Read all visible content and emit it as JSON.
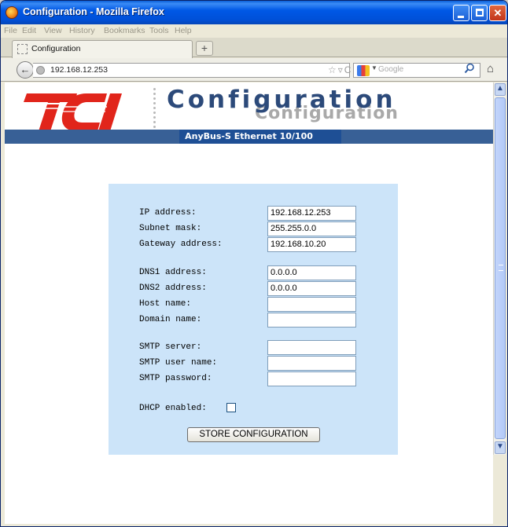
{
  "window": {
    "title": "Configuration - Mozilla Firefox"
  },
  "menu": [
    "File",
    "Edit",
    "View",
    "History",
    "Bookmarks",
    "Tools",
    "Help"
  ],
  "tab": {
    "label": "Configuration",
    "new_tab_label": "+"
  },
  "nav": {
    "url": "192.168.12.253",
    "search_placeholder": "Google",
    "back_label": "←"
  },
  "page": {
    "logo_text": "TCI",
    "heading": "Configuration",
    "heading_shadow": "Configuration",
    "subtitle": "AnyBus-S Ethernet 10/100"
  },
  "form": {
    "ip_label": "IP address:",
    "ip_value": "192.168.12.253",
    "subnet_label": "Subnet mask:",
    "subnet_value": "255.255.0.0",
    "gateway_label": "Gateway address:",
    "gateway_value": "192.168.10.20",
    "dns1_label": "DNS1 address:",
    "dns1_value": "0.0.0.0",
    "dns2_label": "DNS2 address:",
    "dns2_value": "0.0.0.0",
    "host_label": "Host name:",
    "host_value": "",
    "domain_label": "Domain name:",
    "domain_value": "",
    "smtp_server_label": "SMTP server:",
    "smtp_server_value": "",
    "smtp_user_label": "SMTP user name:",
    "smtp_user_value": "",
    "smtp_password_label": "SMTP password:",
    "smtp_password_value": "",
    "dhcp_label": "DHCP enabled:",
    "dhcp_checked": false,
    "store_button": "STORE CONFIGURATION"
  },
  "colors": {
    "accent_bar": "#386096",
    "panel_bg": "#cce4f9",
    "logo_red": "#e1251b",
    "heading": "#2c4a7a"
  }
}
